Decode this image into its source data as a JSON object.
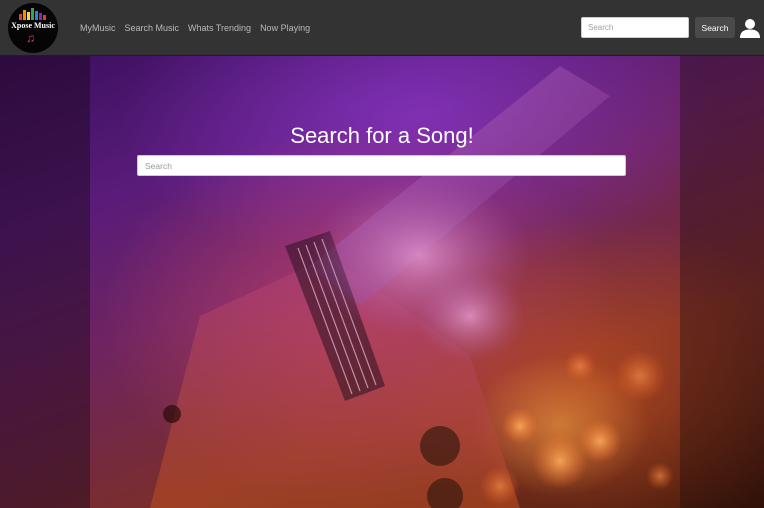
{
  "brand": {
    "logo_text": "Xpose Music",
    "note_glyph": "♫",
    "equalizer_colors": [
      "#e53935",
      "#fb8c00",
      "#fdd835",
      "#43a047",
      "#1e88e5",
      "#8e24aa"
    ]
  },
  "nav": {
    "links": [
      "MyMusic",
      "Search Music",
      "Whats Trending",
      "Now Playing"
    ],
    "search_placeholder": "Search",
    "search_button_label": "Search",
    "user_icon": "user-icon"
  },
  "hero": {
    "title": "Search for a Song!",
    "search_placeholder": "Search"
  },
  "colors": {
    "navbar": "#333333",
    "nav_link": "#b9b9b9",
    "button": "#4a4a4a"
  }
}
